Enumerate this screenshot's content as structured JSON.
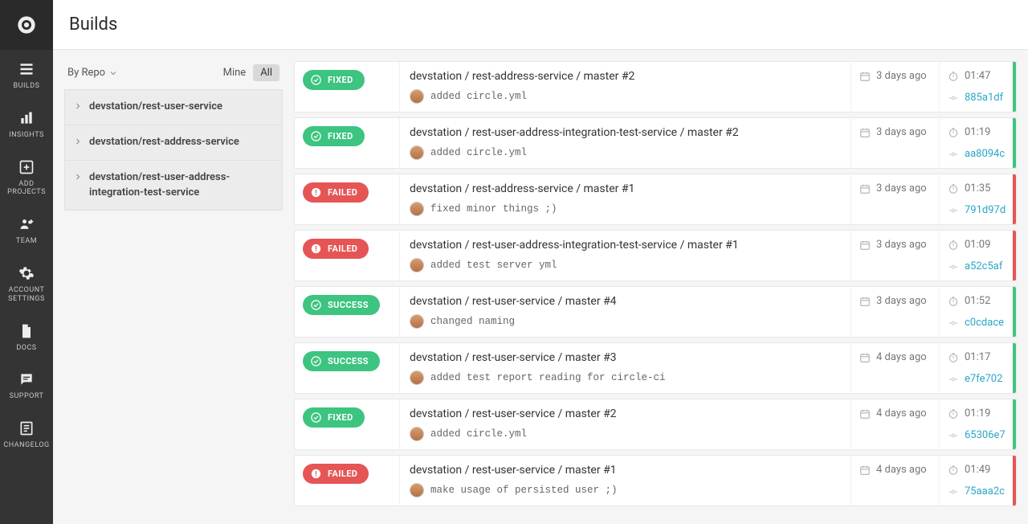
{
  "header": {
    "title": "Builds"
  },
  "sidebar": {
    "items": [
      {
        "label": "BUILDS"
      },
      {
        "label": "INSIGHTS"
      },
      {
        "label": "ADD PROJECTS"
      },
      {
        "label": "TEAM"
      },
      {
        "label": "ACCOUNT SETTINGS"
      },
      {
        "label": "DOCS"
      },
      {
        "label": "SUPPORT"
      },
      {
        "label": "CHANGELOG"
      }
    ]
  },
  "filter": {
    "by_repo_label": "By Repo",
    "mine_label": "Mine",
    "all_label": "All"
  },
  "repos": [
    {
      "name": "devstation/rest-user-service"
    },
    {
      "name": "devstation/rest-address-service"
    },
    {
      "name": "devstation/rest-user-address-integration-test-service"
    }
  ],
  "builds": [
    {
      "status": "FIXED",
      "status_kind": "fixed",
      "title": "devstation / rest-address-service / master #2",
      "commit": "added circle.yml",
      "age": "3 days ago",
      "duration": "01:47",
      "sha": "885a1df"
    },
    {
      "status": "FIXED",
      "status_kind": "fixed",
      "title": "devstation / rest-user-address-integration-test-service / master #2",
      "commit": "added circle.yml",
      "age": "3 days ago",
      "duration": "01:19",
      "sha": "aa8094c"
    },
    {
      "status": "FAILED",
      "status_kind": "failed",
      "title": "devstation / rest-address-service / master #1",
      "commit": "fixed minor things ;)",
      "age": "3 days ago",
      "duration": "01:35",
      "sha": "791d97d"
    },
    {
      "status": "FAILED",
      "status_kind": "failed",
      "title": "devstation / rest-user-address-integration-test-service / master #1",
      "commit": "added test server yml",
      "age": "3 days ago",
      "duration": "01:09",
      "sha": "a52c5af"
    },
    {
      "status": "SUCCESS",
      "status_kind": "success",
      "title": "devstation / rest-user-service / master #4",
      "commit": "changed naming",
      "age": "3 days ago",
      "duration": "01:52",
      "sha": "c0cdace"
    },
    {
      "status": "SUCCESS",
      "status_kind": "success",
      "title": "devstation / rest-user-service / master #3",
      "commit": "added test report reading for circle-ci",
      "age": "4 days ago",
      "duration": "01:17",
      "sha": "e7fe702"
    },
    {
      "status": "FIXED",
      "status_kind": "fixed",
      "title": "devstation / rest-user-service / master #2",
      "commit": "added circle.yml",
      "age": "4 days ago",
      "duration": "01:19",
      "sha": "65306e7"
    },
    {
      "status": "FAILED",
      "status_kind": "failed",
      "title": "devstation / rest-user-service / master #1",
      "commit": "make usage of persisted user ;)",
      "age": "4 days ago",
      "duration": "01:49",
      "sha": "75aaa2c"
    }
  ]
}
